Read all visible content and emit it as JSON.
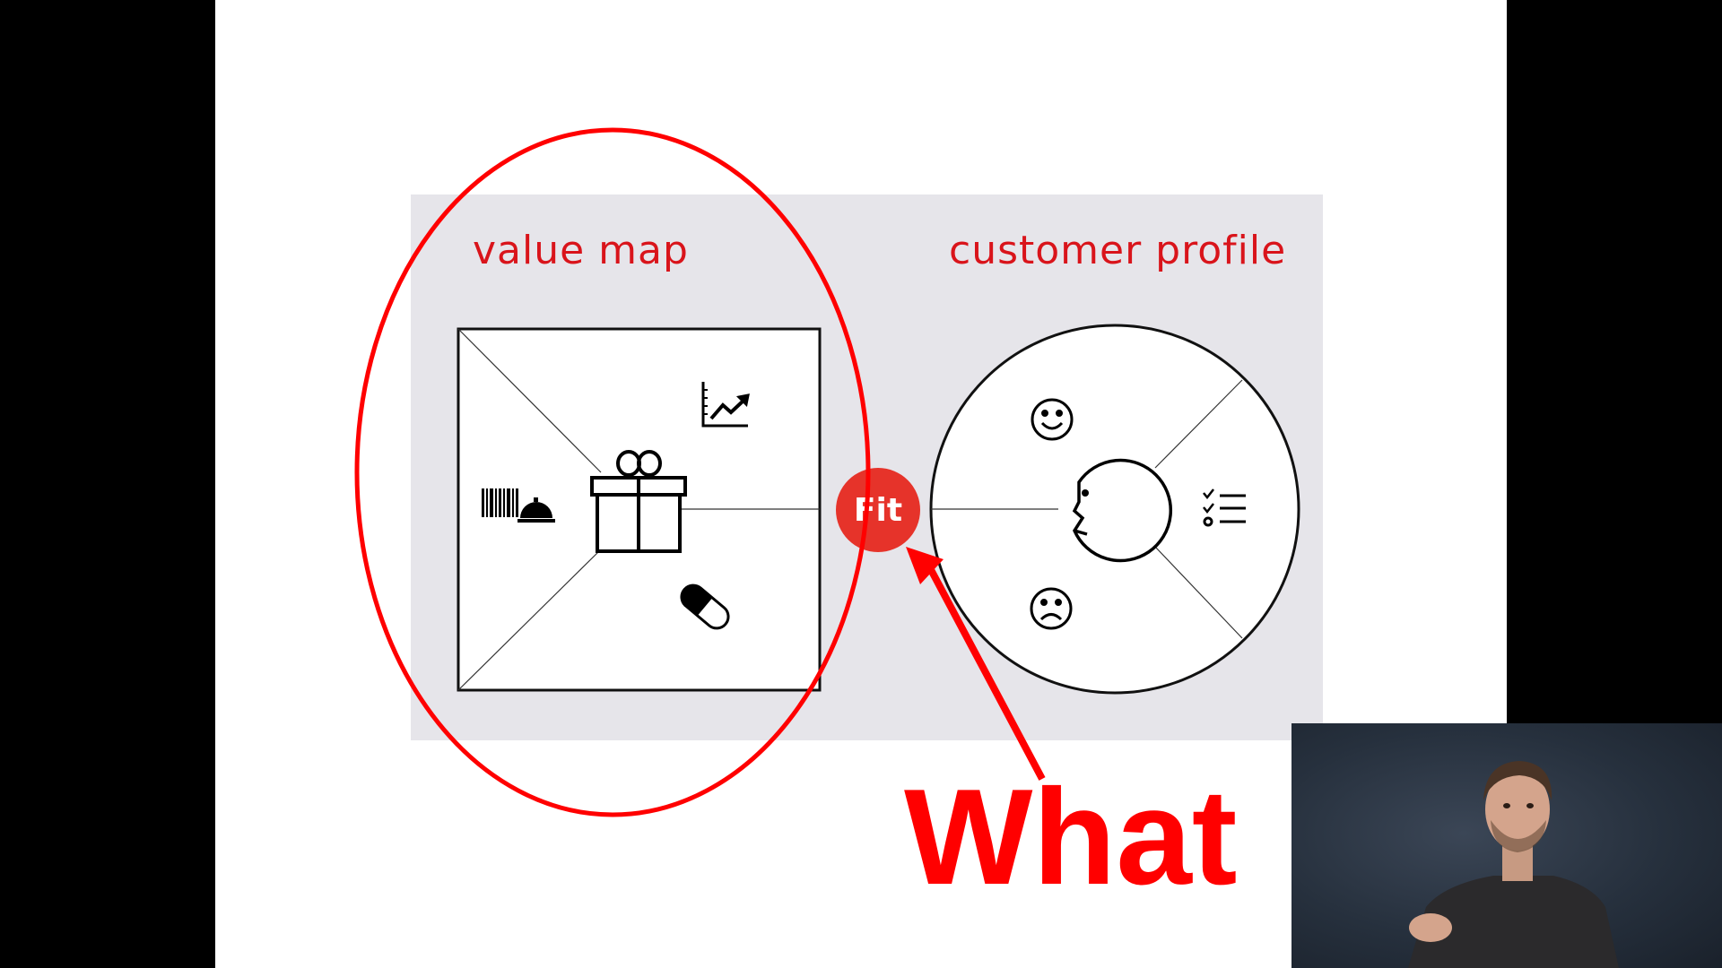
{
  "slide": {
    "value_map_label": "value map",
    "customer_profile_label": "customer profile",
    "fit_label": "Fit",
    "annotation_text": "What",
    "accent_color": "#d9141b",
    "annotation_color": "#ff0000",
    "panel_color": "#e6e5ea"
  },
  "value_map": {
    "icons": [
      "gift-icon",
      "growth-chart-icon",
      "pill-icon",
      "products-services-icon"
    ]
  },
  "customer_profile": {
    "icons": [
      "face-icon",
      "smiley-icon",
      "frown-icon",
      "checklist-icon"
    ]
  },
  "webcam": {
    "subject": "presenter"
  }
}
